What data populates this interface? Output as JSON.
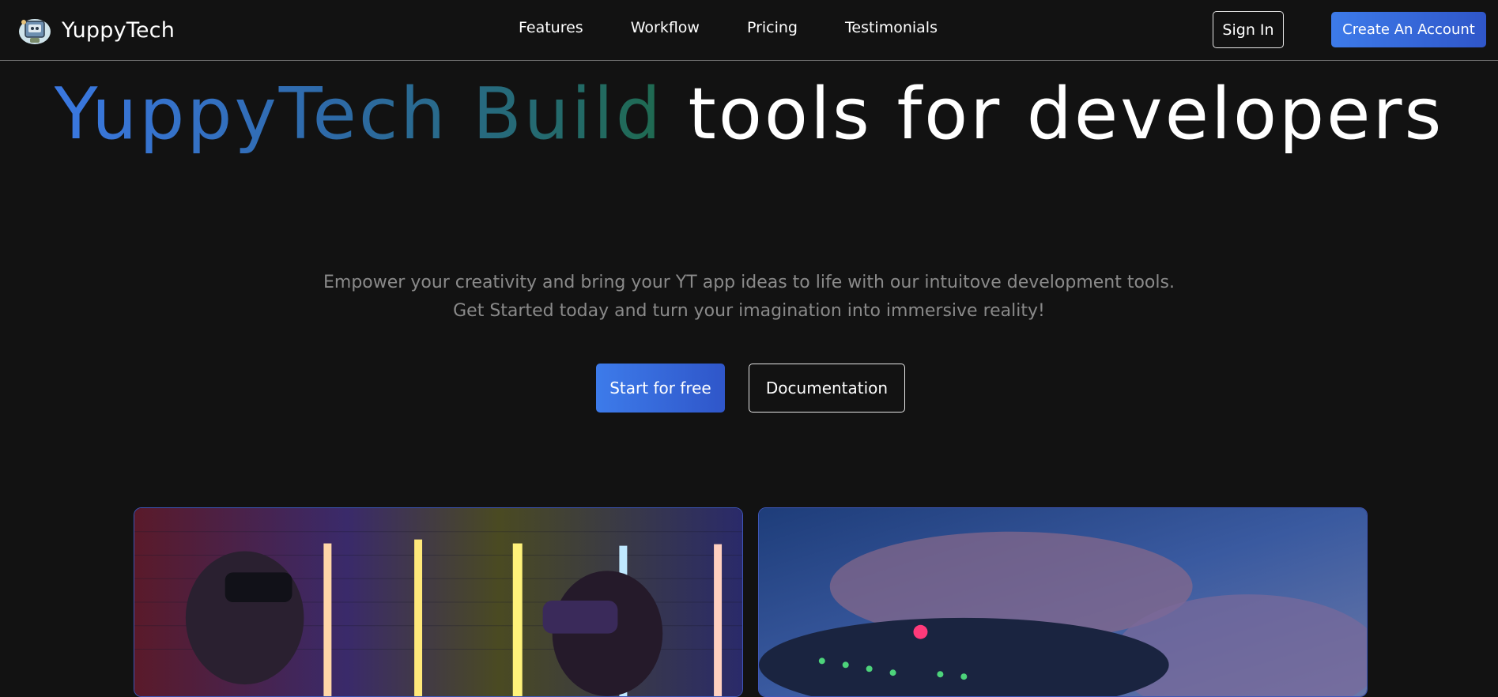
{
  "brand": {
    "name": "YuppyTech",
    "logo_icon": "robot-mascot-icon"
  },
  "nav": {
    "links": [
      "Features",
      "Workflow",
      "Pricing",
      "Testimonials"
    ],
    "sign_in": "Sign In",
    "create_account": "Create An Account"
  },
  "hero": {
    "title_gradient": "YuppyTech Build",
    "title_plain": " tools for developers",
    "subtitle_line1": "Empower your creativity and bring your YT app ideas to life with our intuitove development tools.",
    "subtitle_line2": "Get Started today and turn your imagination into immersive reality!",
    "primary_cta": "Start for free",
    "secondary_cta": "Documentation"
  },
  "colors": {
    "background": "#121212",
    "accent_blue": "#3d7bea",
    "gradient_green": "#1f6a50",
    "subtitle_gray": "#8a8a8a"
  }
}
